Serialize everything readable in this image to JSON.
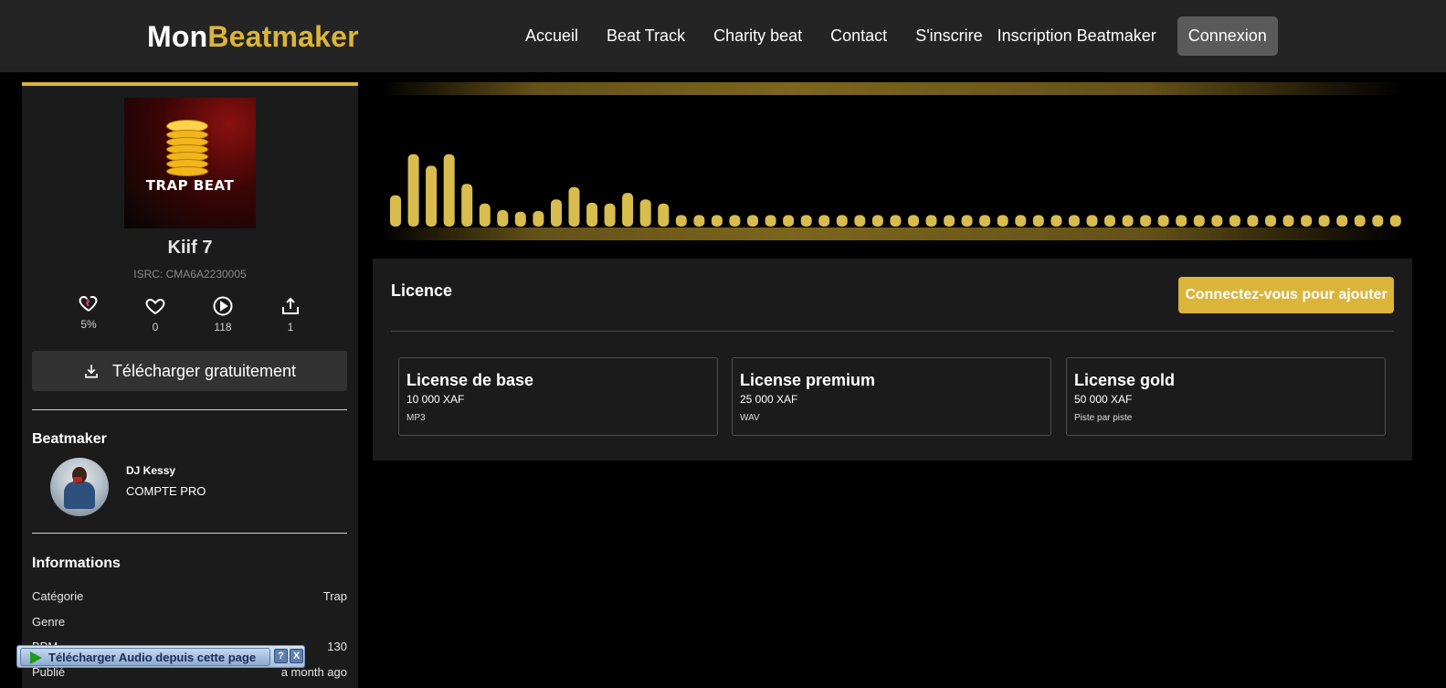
{
  "nav": {
    "logo_white": "Mon",
    "logo_gold": "Beatmaker",
    "links": [
      "Accueil",
      "Beat Track",
      "Charity beat",
      "Contact",
      "S'inscrire",
      "Inscription Beatmaker"
    ],
    "login": "Connexion"
  },
  "track": {
    "cover_text": "TRAP BEAT",
    "title": "Kiif 7",
    "isrc": "ISRC: CMA6A2230005",
    "stats": {
      "heart_percent": "5%",
      "likes": "0",
      "plays": "118",
      "shares": "1"
    },
    "download_label": "Télécharger gratuitement"
  },
  "beatmaker": {
    "heading": "Beatmaker",
    "name": "DJ Kessy",
    "account": "COMPTE PRO"
  },
  "informations": {
    "heading": "Informations",
    "rows": [
      {
        "key": "Catégorie",
        "value": "Trap"
      },
      {
        "key": "Genre",
        "value": ""
      },
      {
        "key": "BPM",
        "value": "130"
      },
      {
        "key": "Publié",
        "value": "a month ago"
      }
    ]
  },
  "waveform": {
    "levels": [
      0.38,
      0.88,
      0.74,
      0.88,
      0.52,
      0.28,
      0.2,
      0.18,
      0.19,
      0.33,
      0.48,
      0.29,
      0.28,
      0.41,
      0.33,
      0.28,
      0.14,
      0.14,
      0.14,
      0.14,
      0.14,
      0.14,
      0.14,
      0.14,
      0.14,
      0.14,
      0.14,
      0.14,
      0.14,
      0.14,
      0.14,
      0.14,
      0.14,
      0.14,
      0.14,
      0.14,
      0.14,
      0.14,
      0.14,
      0.14,
      0.14,
      0.14,
      0.14,
      0.14,
      0.14,
      0.14,
      0.14,
      0.14,
      0.14,
      0.14,
      0.14,
      0.14,
      0.14,
      0.14,
      0.14,
      0.14,
      0.14
    ],
    "bar_color": "#d8bc4e"
  },
  "licence": {
    "title": "Licence",
    "login_button": "Connectez-vous pour ajouter",
    "cards": [
      {
        "name": "License de base",
        "price": "10 000 XAF",
        "format": "MP3"
      },
      {
        "name": "License premium",
        "price": "25 000 XAF",
        "format": "WAV"
      },
      {
        "name": "License gold",
        "price": "50 000 XAF",
        "format": "Piste par piste"
      }
    ]
  },
  "toolbar": {
    "label": "Télécharger Audio depuis cette page",
    "help": "?",
    "close": "X"
  },
  "colors": {
    "accent": "#dbb43a",
    "panel": "#1b1b1b",
    "navbar": "#242424"
  }
}
